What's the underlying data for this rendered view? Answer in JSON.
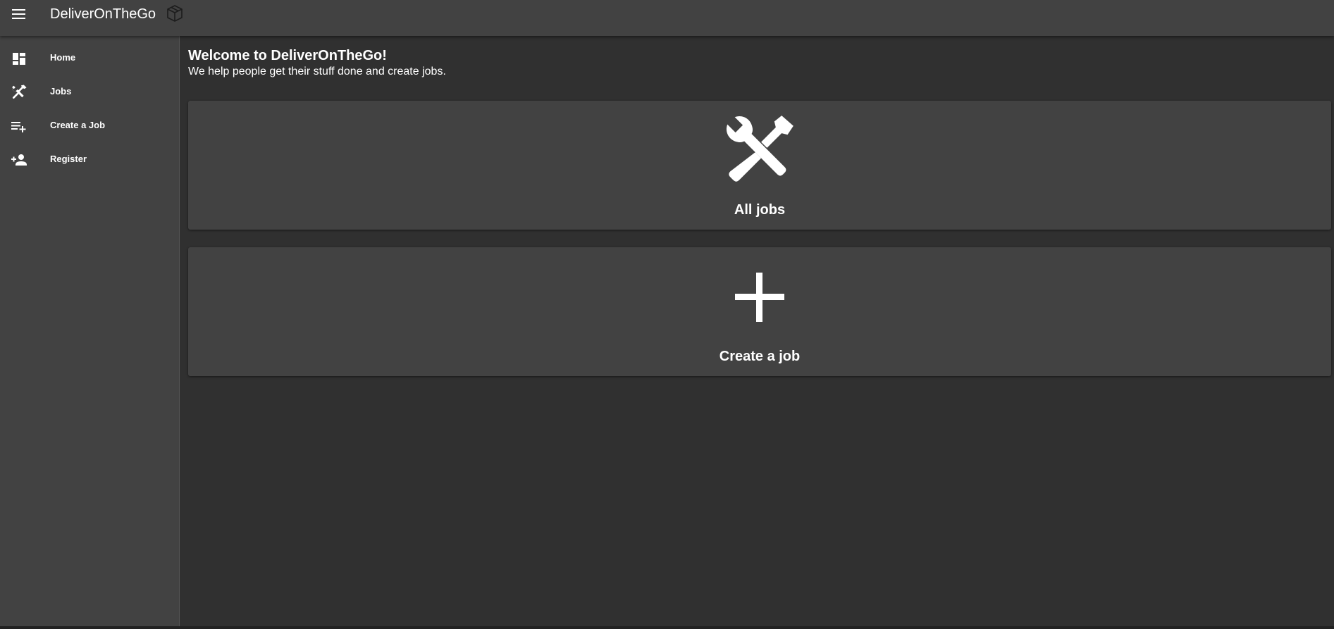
{
  "header": {
    "app_title": "DeliverOnTheGo",
    "menu_icon": "menu-icon",
    "logo_icon": "package-box-icon"
  },
  "sidebar": {
    "items": [
      {
        "label": "Home",
        "icon": "dashboard-icon"
      },
      {
        "label": "Jobs",
        "icon": "tools-icon"
      },
      {
        "label": "Create a Job",
        "icon": "playlist-add-icon"
      },
      {
        "label": "Register",
        "icon": "person-add-icon"
      }
    ]
  },
  "main": {
    "welcome_title": "Welcome to DeliverOnTheGo!",
    "welcome_subtitle": "We help people get their stuff done and create jobs.",
    "cards": [
      {
        "label": "All jobs",
        "icon": "tools-icon"
      },
      {
        "label": "Create a job",
        "icon": "plus-icon"
      }
    ]
  },
  "colors": {
    "background": "#303030",
    "surface": "#424242",
    "text": "#ffffff"
  }
}
